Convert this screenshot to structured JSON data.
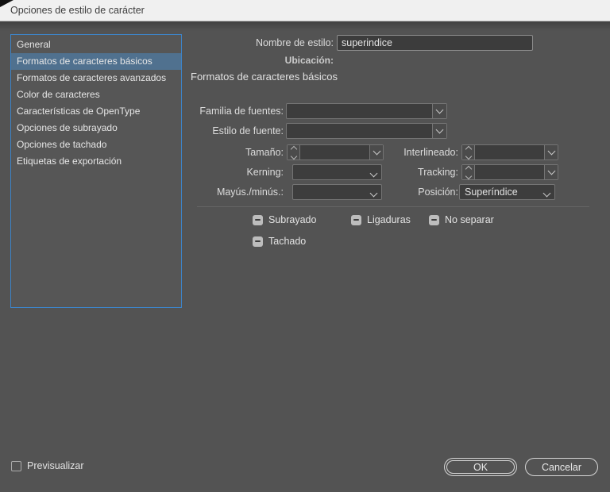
{
  "window": {
    "title": "Opciones de estilo de carácter"
  },
  "sidebar": {
    "items": [
      {
        "label": "General",
        "selected": false
      },
      {
        "label": "Formatos de caracteres básicos",
        "selected": true
      },
      {
        "label": "Formatos de caracteres avanzados",
        "selected": false
      },
      {
        "label": "Color de caracteres",
        "selected": false
      },
      {
        "label": "Características de OpenType",
        "selected": false
      },
      {
        "label": "Opciones de subrayado",
        "selected": false
      },
      {
        "label": "Opciones de tachado",
        "selected": false
      },
      {
        "label": "Etiquetas de exportación",
        "selected": false
      }
    ]
  },
  "header": {
    "style_name_label": "Nombre de estilo:",
    "style_name_value": "superindice",
    "location_label": "Ubicación:",
    "location_value": "",
    "section_title": "Formatos de caracteres básicos"
  },
  "form": {
    "font_family_label": "Familia de fuentes:",
    "font_family_value": "",
    "font_style_label": "Estilo de fuente:",
    "font_style_value": "",
    "size_label": "Tamaño:",
    "size_value": "",
    "leading_label": "Interlineado:",
    "leading_value": "",
    "kerning_label": "Kerning:",
    "kerning_value": "",
    "tracking_label": "Tracking:",
    "tracking_value": "",
    "case_label": "Mayús./minús.:",
    "case_value": "",
    "position_label": "Posición:",
    "position_value": "Superíndice"
  },
  "checkboxes": [
    {
      "label": "Subrayado",
      "state": "indeterminate"
    },
    {
      "label": "Ligaduras",
      "state": "indeterminate"
    },
    {
      "label": "No separar",
      "state": "indeterminate"
    },
    {
      "label": "Tachado",
      "state": "indeterminate"
    }
  ],
  "footer": {
    "preview_label": "Previsualizar",
    "preview_checked": false,
    "ok_label": "OK",
    "cancel_label": "Cancelar"
  },
  "colors": {
    "titlebar_bg": "#f0f0f0",
    "dialog_bg": "#535353",
    "field_bg": "#3d3d3d",
    "sidebar_border_accent": "#3d84c8",
    "sidebar_selected_bg": "#50718f",
    "checkbox_bg": "#bdbdbd",
    "text_light": "#e3e3e3"
  }
}
